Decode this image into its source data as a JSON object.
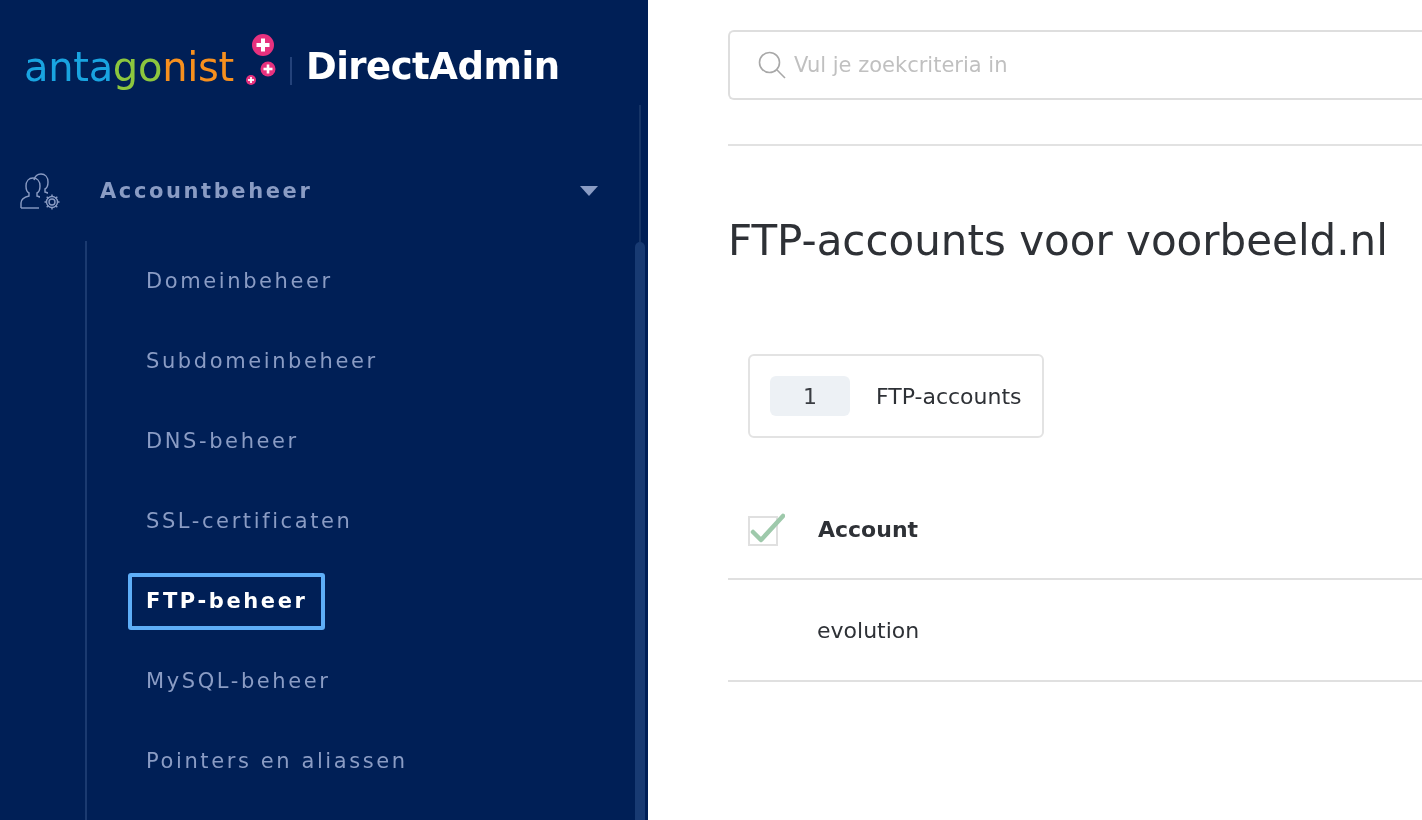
{
  "logo": {
    "brand": "antagonist",
    "product": "DirectAdmin"
  },
  "sidebar": {
    "group": {
      "label": "Accountbeheer",
      "expanded": true,
      "items": [
        {
          "label": "Domeinbeheer",
          "selected": false
        },
        {
          "label": "Subdomeinbeheer",
          "selected": false
        },
        {
          "label": "DNS-beheer",
          "selected": false
        },
        {
          "label": "SSL-certificaten",
          "selected": false
        },
        {
          "label": "FTP-beheer",
          "selected": true
        },
        {
          "label": "MySQL-beheer",
          "selected": false
        },
        {
          "label": "Pointers en aliassen",
          "selected": false
        }
      ]
    }
  },
  "search": {
    "placeholder": "Vul je zoekcriteria in"
  },
  "page_title": "FTP-accounts voor voorbeeld.nl",
  "summary": {
    "count": "1",
    "label": "FTP-accounts"
  },
  "table": {
    "select_all": {
      "checked": true
    },
    "columns": [
      "Account"
    ],
    "rows": [
      {
        "cells": [
          "evolution"
        ]
      }
    ]
  }
}
